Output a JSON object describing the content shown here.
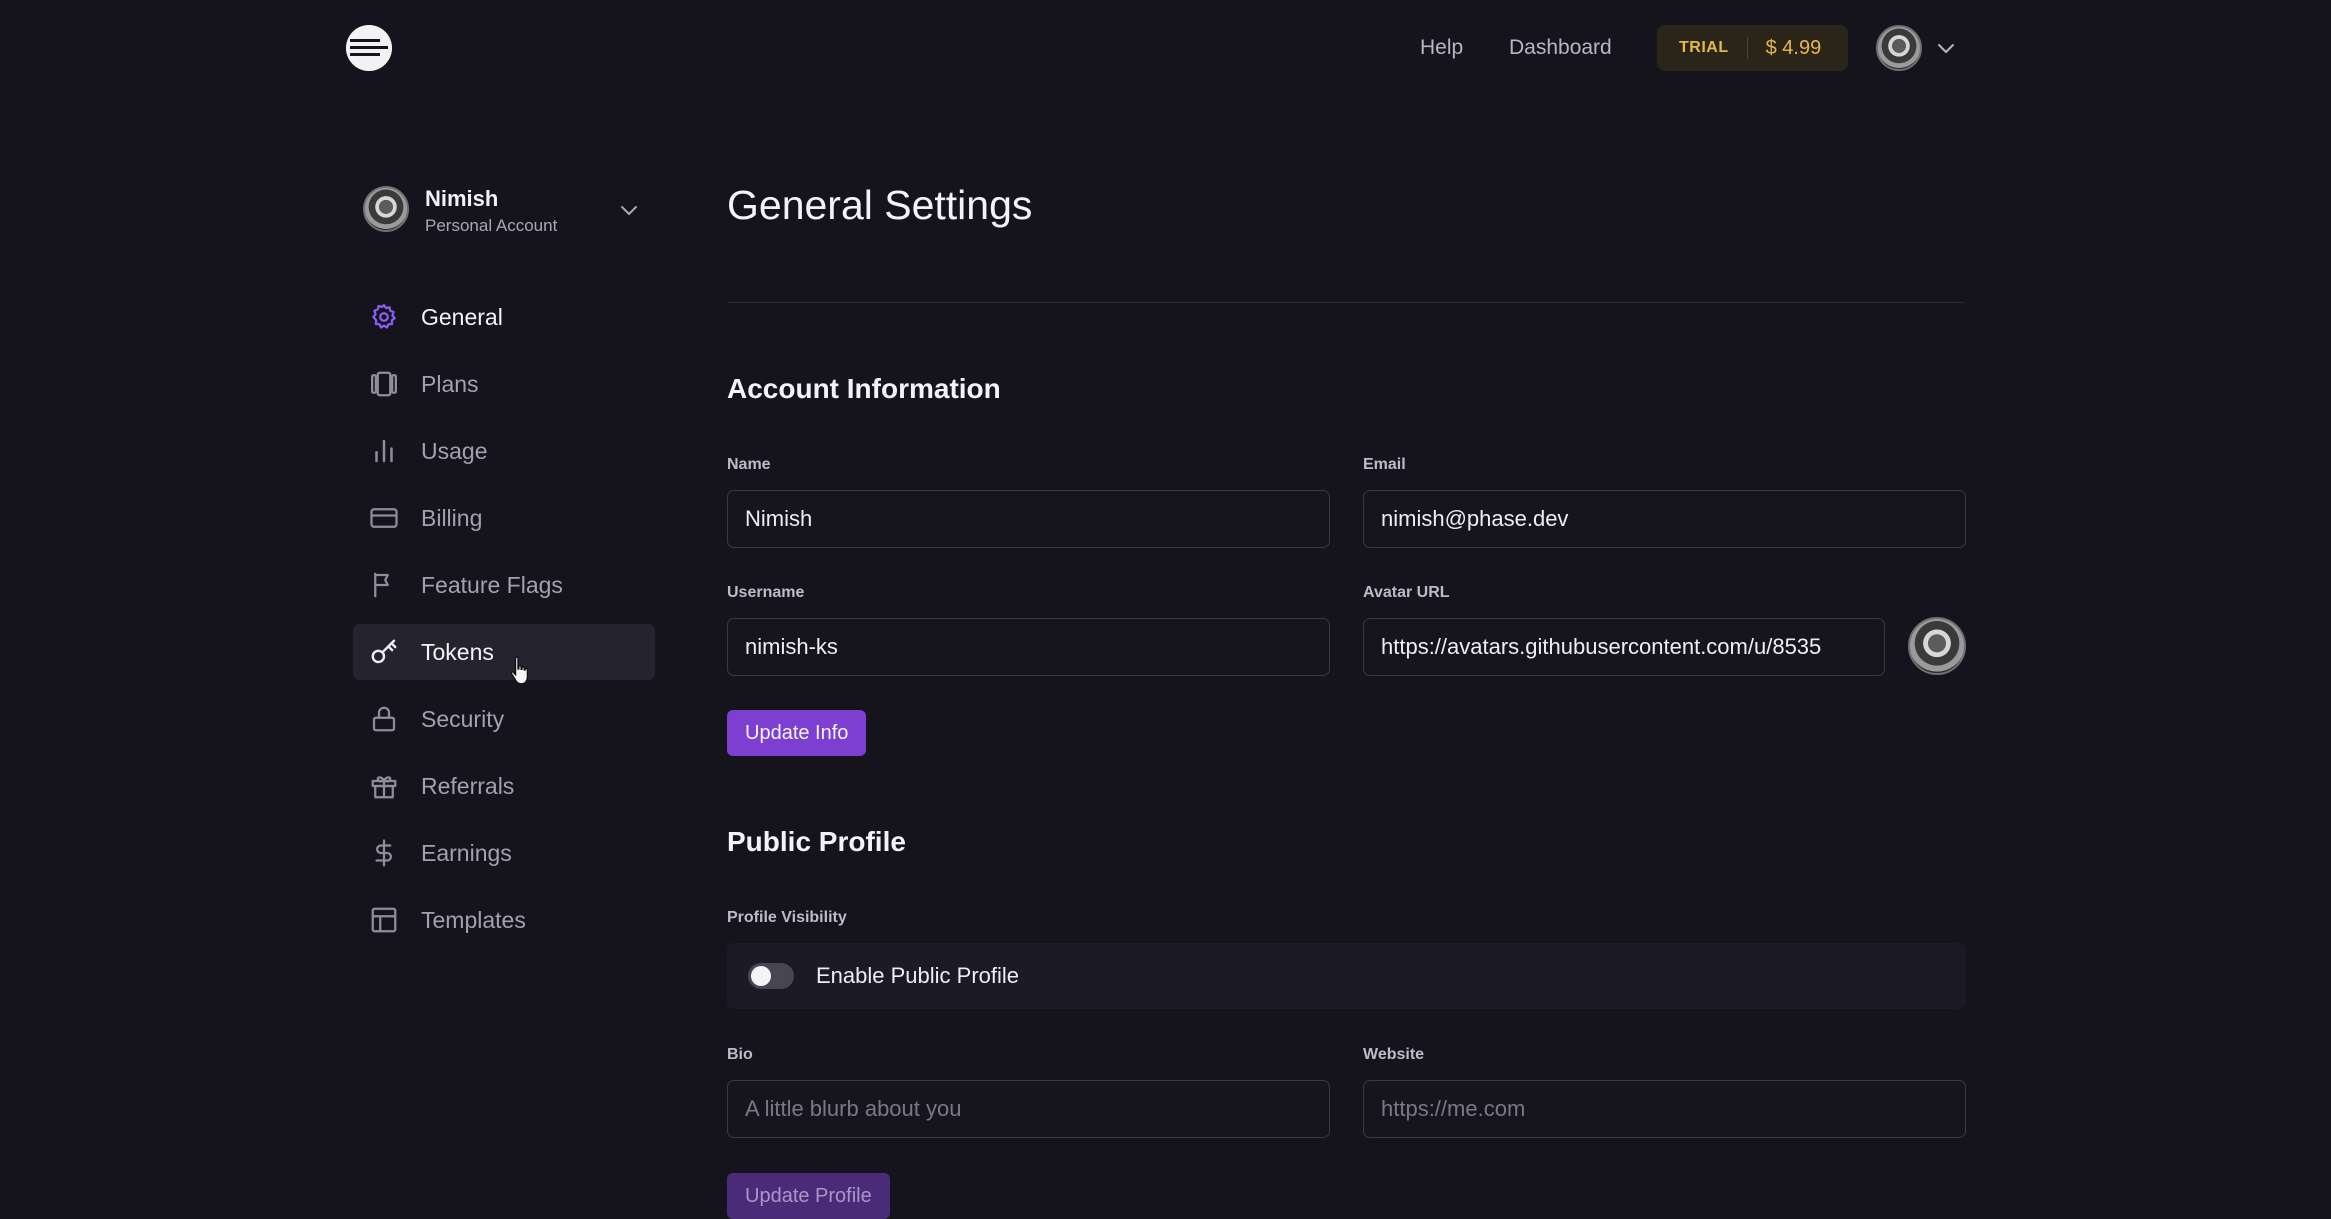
{
  "header": {
    "help_label": "Help",
    "dashboard_label": "Dashboard",
    "trial_label": "TRIAL",
    "balance": "$ 4.99",
    "accent_color": "#e6b84a"
  },
  "account": {
    "name": "Nimish",
    "type": "Personal Account"
  },
  "sidebar": {
    "items": [
      {
        "label": "General",
        "icon": "gear-icon",
        "state": "active"
      },
      {
        "label": "Plans",
        "icon": "plans-icon"
      },
      {
        "label": "Usage",
        "icon": "bar-chart-icon"
      },
      {
        "label": "Billing",
        "icon": "credit-card-icon"
      },
      {
        "label": "Feature Flags",
        "icon": "flag-icon"
      },
      {
        "label": "Tokens",
        "icon": "key-icon",
        "state": "hover"
      },
      {
        "label": "Security",
        "icon": "lock-icon"
      },
      {
        "label": "Referrals",
        "icon": "gift-icon"
      },
      {
        "label": "Earnings",
        "icon": "dollar-icon"
      },
      {
        "label": "Templates",
        "icon": "template-icon"
      }
    ],
    "active_color": "#8b5cf6"
  },
  "main": {
    "title": "General Settings",
    "account_info": {
      "heading": "Account Information",
      "name_label": "Name",
      "name_value": "Nimish",
      "email_label": "Email",
      "email_value": "nimish@phase.dev",
      "username_label": "Username",
      "username_value": "nimish-ks",
      "avatar_label": "Avatar URL",
      "avatar_value": "https://avatars.githubusercontent.com/u/8535",
      "update_button": "Update Info"
    },
    "public_profile": {
      "heading": "Public Profile",
      "visibility_label": "Profile Visibility",
      "toggle_label": "Enable Public Profile",
      "toggle_on": false,
      "bio_label": "Bio",
      "bio_placeholder": "A little blurb about you",
      "website_label": "Website",
      "website_placeholder": "https://me.com",
      "update_button": "Update Profile"
    },
    "button_color": "#7c3fd1"
  }
}
